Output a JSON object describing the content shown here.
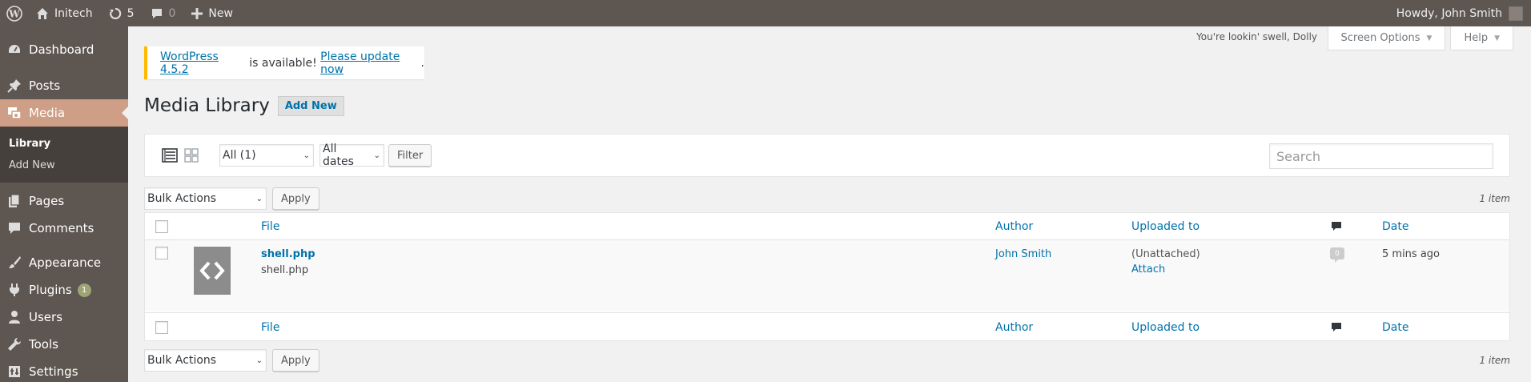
{
  "admin_bar": {
    "site_name": "Initech",
    "updates_count": "5",
    "comments_count": "0",
    "new_label": "New",
    "greeting": "Howdy, John Smith"
  },
  "menu": {
    "dashboard": "Dashboard",
    "posts": "Posts",
    "media": "Media",
    "media_sub": {
      "library": "Library",
      "add_new": "Add New"
    },
    "pages": "Pages",
    "comments": "Comments",
    "appearance": "Appearance",
    "plugins": "Plugins",
    "plugins_badge": "1",
    "users": "Users",
    "tools": "Tools",
    "settings": "Settings"
  },
  "header": {
    "dolly": "You're lookin' swell, Dolly",
    "screen_options": "Screen Options",
    "help": "Help"
  },
  "notice": {
    "version_link": "WordPress 4.5.2",
    "middle": " is available! ",
    "update_link": "Please update now",
    "end": "."
  },
  "page": {
    "title": "Media Library",
    "add_new": "Add New"
  },
  "filters": {
    "type_value": "All (1)",
    "date_value": "All dates",
    "filter_button": "Filter",
    "search_placeholder": "Search"
  },
  "bulk": {
    "label": "Bulk Actions",
    "apply": "Apply",
    "count": "1 item"
  },
  "table": {
    "columns": {
      "file": "File",
      "author": "Author",
      "uploaded_to": "Uploaded to",
      "date": "Date"
    },
    "rows": [
      {
        "title": "shell.php",
        "filename": "shell.php",
        "author": "John Smith",
        "uploaded_to": "(Unattached)",
        "attach": "Attach",
        "comments": "0",
        "date": "5 mins ago"
      }
    ]
  },
  "colors": {
    "accent": "#cf9e86",
    "admin_bg": "#5e5650",
    "link": "#0073aa",
    "notice_warning": "#ffb900"
  }
}
